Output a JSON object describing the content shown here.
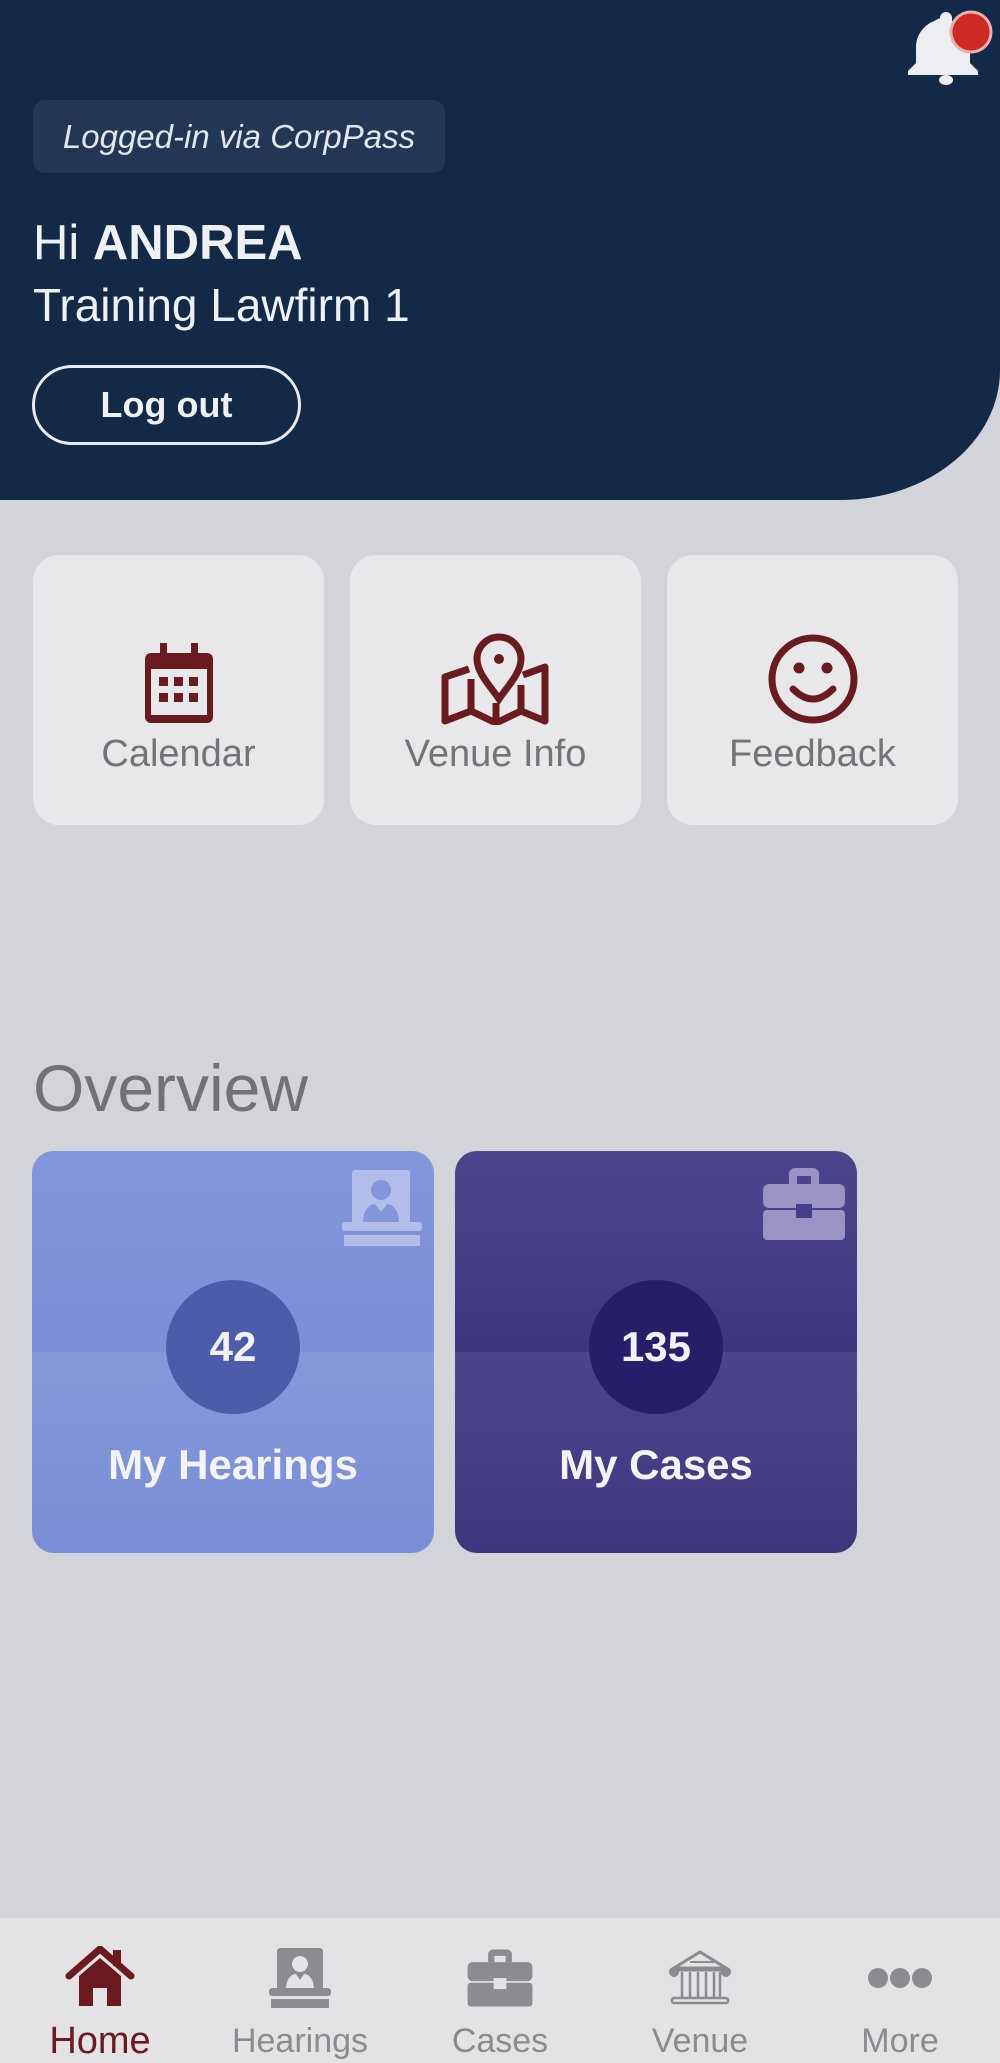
{
  "header": {
    "login_method": "Logged-in via CorpPass",
    "greeting_prefix": "Hi",
    "user_name": "ANDREA",
    "organization": "Training Lawfirm 1",
    "logout_label": "Log out",
    "notification_icon": "bell-icon",
    "has_unread_notifications": true
  },
  "quick_links": [
    {
      "label": "Calendar",
      "icon": "calendar-icon"
    },
    {
      "label": "Venue Info",
      "icon": "map-pin-icon"
    },
    {
      "label": "Feedback",
      "icon": "smiley-icon"
    }
  ],
  "overview": {
    "title": "Overview",
    "cards": [
      {
        "label": "My Hearings",
        "count": "42",
        "icon": "hearing-icon"
      },
      {
        "label": "My Cases",
        "count": "135",
        "icon": "briefcase-icon"
      }
    ]
  },
  "tabbar": {
    "active": "Home",
    "items": [
      {
        "label": "Home",
        "icon": "home-icon"
      },
      {
        "label": "Hearings",
        "icon": "hearing-icon"
      },
      {
        "label": "Cases",
        "icon": "briefcase-icon"
      },
      {
        "label": "Venue",
        "icon": "courthouse-icon"
      },
      {
        "label": "More",
        "icon": "more-icon"
      }
    ]
  },
  "colors": {
    "header_bg": "#122948",
    "page_bg": "#d3d4d9",
    "accent_maroon": "#6b1a1f",
    "hearings_card": "#7f94da",
    "cases_card": "#463d88",
    "notification_dot": "#cc2a22",
    "inactive_tab": "#8c8c90"
  }
}
